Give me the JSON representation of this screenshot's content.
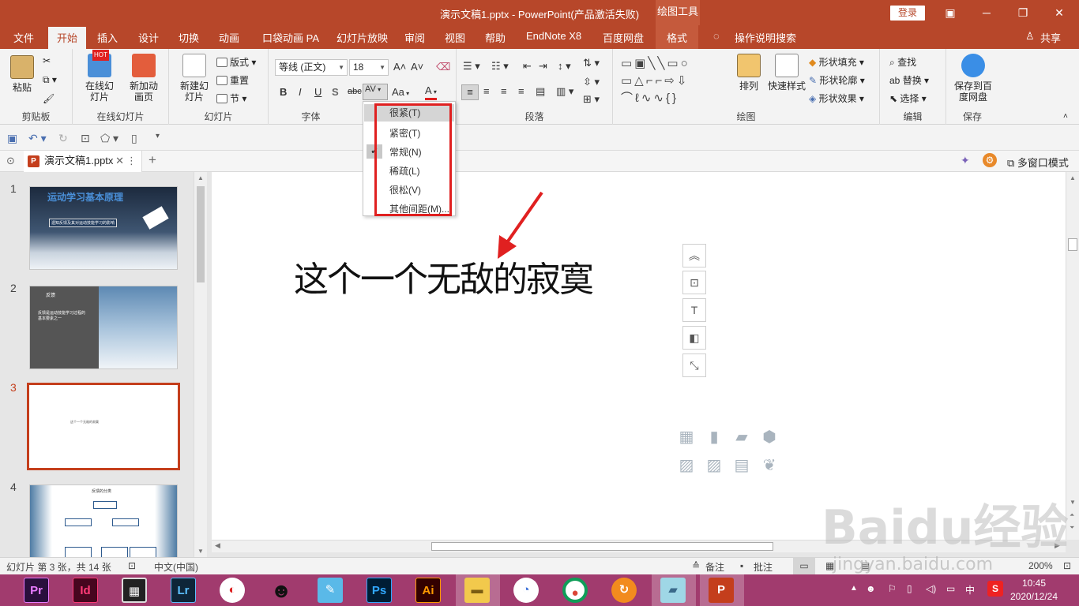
{
  "window": {
    "title": "演示文稿1.pptx  -  PowerPoint(产品激活失败)",
    "context_tab": "绘图工具",
    "login": "登录",
    "ribbon_display_icon": "ribbon-display-icon",
    "minimize": "─",
    "restore": "❐",
    "close": "✕"
  },
  "tabs": [
    "文件",
    "开始",
    "插入",
    "设计",
    "切换",
    "动画",
    "口袋动画 PA",
    "幻灯片放映",
    "审阅",
    "视图",
    "帮助",
    "EndNote X8",
    "百度网盘",
    "格式"
  ],
  "tell_me": "操作说明搜索",
  "share": "共享",
  "ribbon": {
    "clipboard": {
      "paste": "粘贴",
      "label": "剪贴板"
    },
    "online_slides": {
      "online": "在线幻灯片",
      "new_anim": "新加动画页",
      "hot": "HOT",
      "label": "在线幻灯片"
    },
    "slides": {
      "new_slide": "新建幻灯片",
      "layout": "版式",
      "reset": "重置",
      "section": "节",
      "label": "幻灯片"
    },
    "font": {
      "name": "等线 (正文)",
      "size": "18",
      "label": "字体",
      "bold": "B",
      "italic": "I",
      "underline": "U",
      "shadow": "S",
      "strike": "abc",
      "spacing": "AV",
      "case": "Aa",
      "color": "A"
    },
    "paragraph": {
      "label": "段落"
    },
    "drawing": {
      "arrange": "排列",
      "quick_styles": "快速样式",
      "fill": "形状填充",
      "outline": "形状轮廓",
      "effects": "形状效果",
      "label": "绘图"
    },
    "editing": {
      "find": "查找",
      "replace": "替换",
      "select": "选择",
      "label": "编辑"
    },
    "save": {
      "save_to_baidu": "保存到百度网盘",
      "label": "保存"
    }
  },
  "doc_tab": {
    "name": "演示文稿1.pptx",
    "badge": "P",
    "multiwindow": "多窗口模式"
  },
  "slides": [
    {
      "num": "1",
      "title": "运动学习基本原理",
      "subtitle": "遗知反馈及其对运动技能学习的影响"
    },
    {
      "num": "2",
      "title": "反馈",
      "body": "反馈是运动技能学习过程的基本要素之一"
    },
    {
      "num": "3",
      "body": "这个一个无敌的寂寞"
    },
    {
      "num": "4",
      "title": "反馈的分类"
    }
  ],
  "slide_text": "这个一个无敌的寂寞",
  "spacing_menu": {
    "items": [
      "很紧(T)",
      "紧密(T)",
      "常规(N)",
      "稀疏(L)",
      "很松(V)",
      "其他间距(M)..."
    ],
    "highlighted": "很紧(T)",
    "checked": "常规(N)"
  },
  "status": {
    "slide_info": "幻灯片 第 3 张，共 14 张",
    "language": "中文(中国)",
    "notes": "备注",
    "comments": "批注",
    "zoom": "200%"
  },
  "taskbar": {
    "apps": [
      "Pr",
      "Id",
      "video",
      "Lr",
      "games",
      "QQ",
      "chat",
      "Ps",
      "Ai",
      "explorer",
      "browser",
      "chrome",
      "foxit",
      "notes",
      "P"
    ],
    "time": "10:45",
    "date": "2020/12/24",
    "ime": "中"
  },
  "watermark": {
    "main": "Baidu经验",
    "url": "jingyan.baidu.com"
  },
  "colors": {
    "accent": "#b7472a",
    "selected_slide": "#c43e1c",
    "taskbar": "#a13b6e",
    "annotation": "#e02020"
  }
}
